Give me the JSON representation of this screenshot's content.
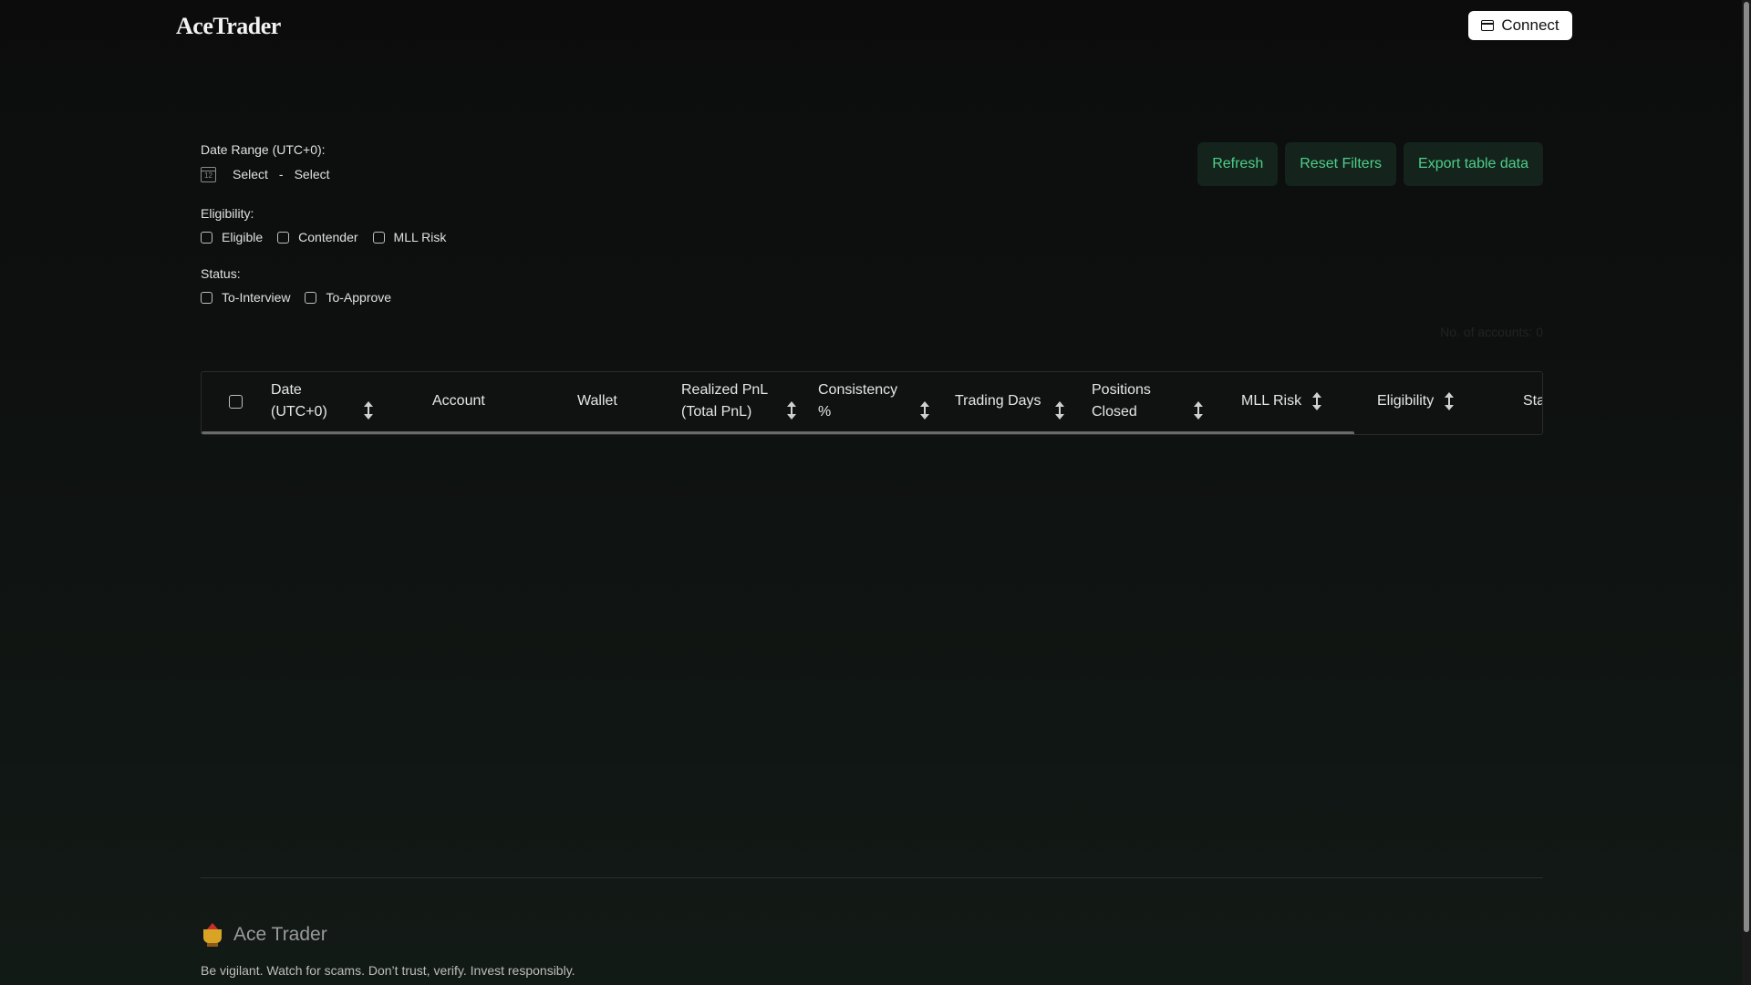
{
  "header": {
    "logo": "AceTrader",
    "connect_label": "Connect"
  },
  "filters": {
    "date_range_label": "Date Range (UTC+0):",
    "calendar_glyph": "12",
    "date_start": "Select",
    "date_separator": "-",
    "date_end": "Select",
    "eligibility_label": "Eligibility:",
    "eligibility_options": [
      "Eligible",
      "Contender",
      "MLL Risk"
    ],
    "status_label": "Status:",
    "status_options": [
      "To-Interview",
      "To-Approve"
    ]
  },
  "actions": {
    "refresh": "Refresh",
    "reset": "Reset Filters",
    "export": "Export table data"
  },
  "table": {
    "count_text": "No. of accounts: 0",
    "columns": [
      {
        "label": "Date (UTC+0)",
        "sortable": true
      },
      {
        "label": "Account",
        "sortable": false
      },
      {
        "label": "Wallet",
        "sortable": false
      },
      {
        "label": "Realized PnL (Total PnL)",
        "sortable": true
      },
      {
        "label": "Consistency %",
        "sortable": true
      },
      {
        "label": "Trading Days",
        "sortable": true
      },
      {
        "label": "Positions Closed",
        "sortable": true
      },
      {
        "label": "MLL Risk",
        "sortable": true
      },
      {
        "label": "Eligibility",
        "sortable": true
      },
      {
        "label": "Sta",
        "sortable": false
      }
    ]
  },
  "footer": {
    "brand": "Ace Trader",
    "note": "Be vigilant. Watch for scams. Don’t trust, verify. Invest responsibly."
  },
  "colors": {
    "accent": "#4fce8a",
    "button_bg": "#14241c",
    "background": "#0c0c0c"
  }
}
